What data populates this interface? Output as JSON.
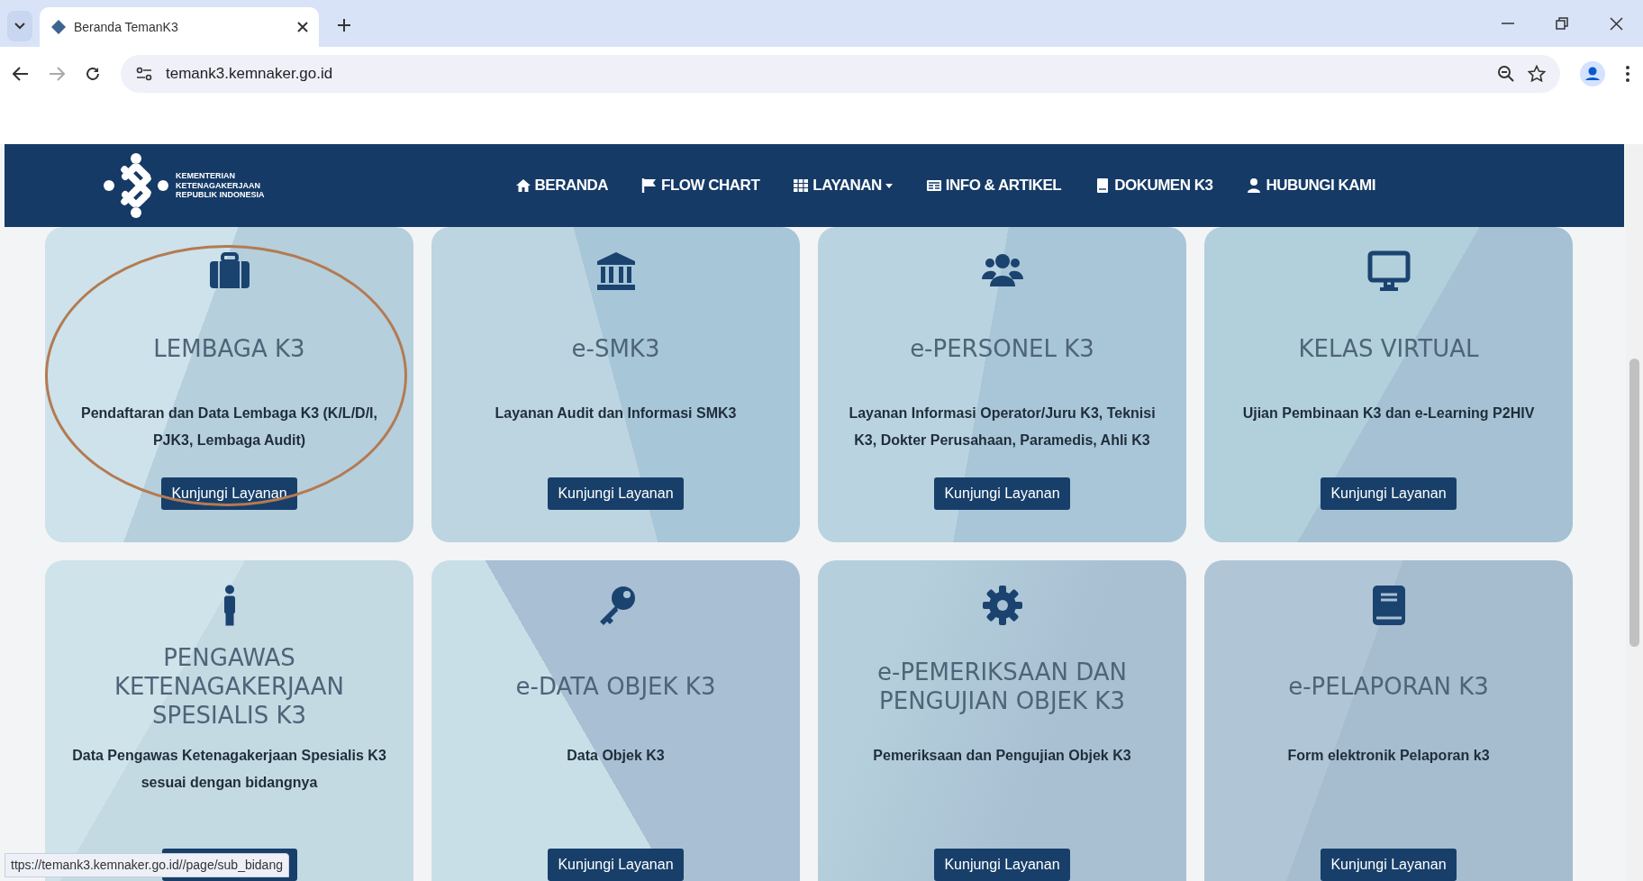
{
  "browser": {
    "tab_title": "Beranda TemanK3",
    "url": "temank3.kemnaker.go.id",
    "status_url": "ttps://temank3.kemnaker.go.id//page/sub_bidang"
  },
  "navbar": {
    "logo_lines": [
      "KEMENTERIAN",
      "KETENAGAKERJAAN",
      "REPUBLIK INDONESIA"
    ],
    "items": [
      {
        "label": "BERANDA",
        "dropdown": false
      },
      {
        "label": "FLOW CHART",
        "dropdown": false
      },
      {
        "label": "LAYANAN",
        "dropdown": true
      },
      {
        "label": "INFO & ARTIKEL",
        "dropdown": false
      },
      {
        "label": "DOKUMEN K3",
        "dropdown": false
      },
      {
        "label": "HUBUNGI KAMI",
        "dropdown": false
      }
    ]
  },
  "cards": [
    {
      "title": "LEMBAGA K3",
      "description": "Pendaftaran dan Data Lembaga K3 (K/L/D/I, PJK3, Lembaga Audit)",
      "button": "Kunjungi Layanan"
    },
    {
      "title": "e-SMK3",
      "description": "Layanan Audit dan Informasi SMK3",
      "button": "Kunjungi Layanan"
    },
    {
      "title": "e-PERSONEL K3",
      "description": "Layanan Informasi Operator/Juru K3, Teknisi K3, Dokter Perusahaan, Paramedis, Ahli K3",
      "button": "Kunjungi Layanan"
    },
    {
      "title": "KELAS VIRTUAL",
      "description": "Ujian Pembinaan K3 dan e-Learning P2HIV",
      "button": "Kunjungi Layanan"
    },
    {
      "title": "PENGAWAS KETENAGAKERJAAN SPESIALIS K3",
      "description": "Data Pengawas Ketenagakerjaan Spesialis K3 sesuai dengan bidangnya"
    },
    {
      "title": "e-DATA OBJEK K3",
      "description": "Data Objek K3",
      "button": "Kunjungi Layanan"
    },
    {
      "title": "e-PEMERIKSAAN DAN PENGUJIAN OBJEK K3",
      "description": "Pemeriksaan dan Pengujian Objek K3",
      "button": "Kunjungi Layanan"
    },
    {
      "title": "e-PELAPORAN K3",
      "description": "Form elektronik Pelaporan k3",
      "button": "Kunjungi Layanan"
    }
  ],
  "annotation": {
    "kind": "ellipse"
  }
}
